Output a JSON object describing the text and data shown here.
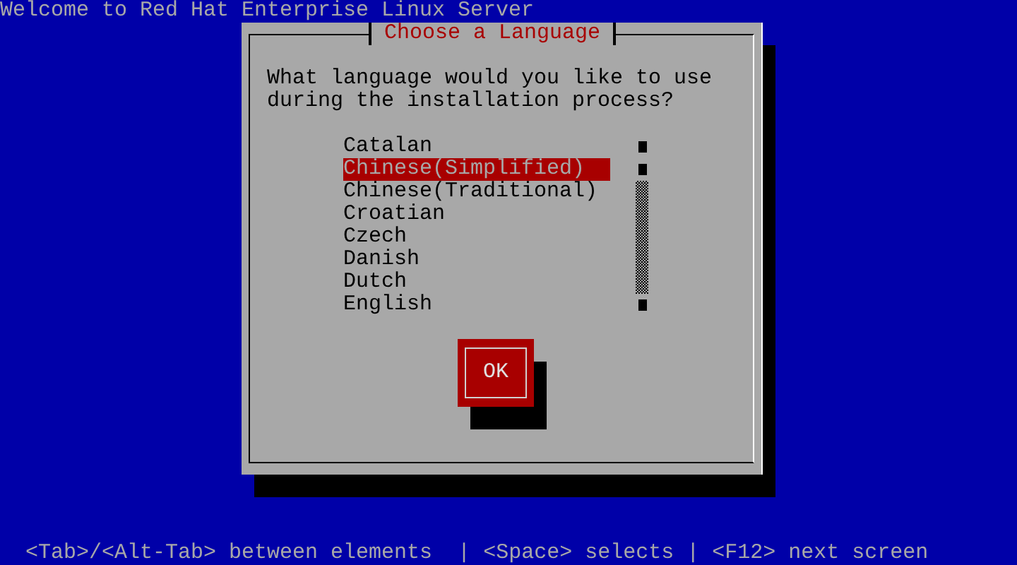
{
  "header": "Welcome to Red Hat Enterprise Linux Server",
  "dialog": {
    "title": "Choose a Language",
    "prompt": [
      "What language would you like to use",
      "during the installation process?"
    ],
    "languages": [
      {
        "label": "Catalan",
        "selected": false
      },
      {
        "label": "Chinese(Simplified)",
        "selected": true
      },
      {
        "label": "Chinese(Traditional)",
        "selected": false
      },
      {
        "label": "Croatian",
        "selected": false
      },
      {
        "label": "Czech",
        "selected": false
      },
      {
        "label": "Danish",
        "selected": false
      },
      {
        "label": "Dutch",
        "selected": false
      },
      {
        "label": "English",
        "selected": false
      }
    ],
    "button": "OK"
  },
  "help_bar": [
    "<Tab>/<Alt-Tab> between elements",
    "|",
    "<Space> selects",
    "|",
    "<F12> next screen"
  ]
}
